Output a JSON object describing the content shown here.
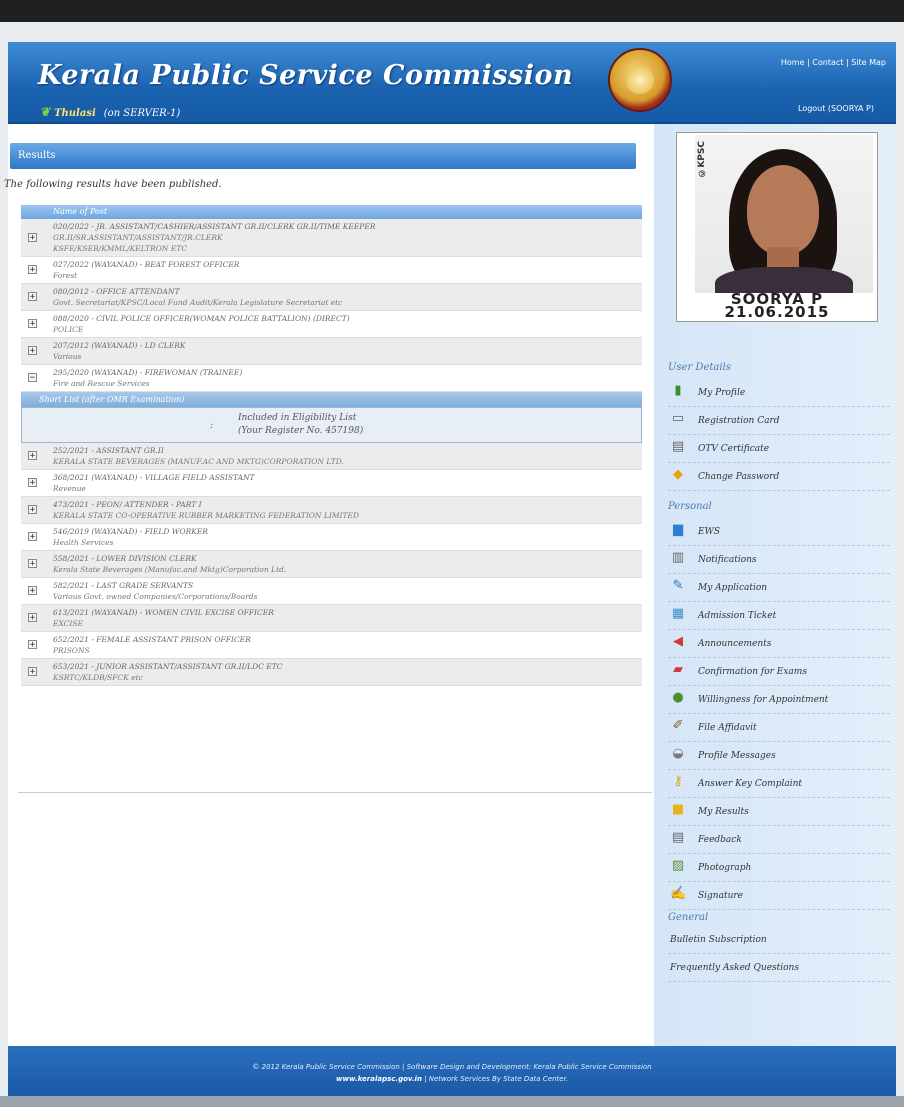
{
  "header": {
    "title": "Kerala Public Service Commission",
    "brand": "Thulasi",
    "server": "(on SERVER-1)",
    "links": [
      "Home",
      "Contact",
      "Site Map"
    ],
    "logout": "Logout (SOORYA P)"
  },
  "results": {
    "heading": "Results",
    "intro": "The following results have been published.",
    "column_header": "Name of Post",
    "rows_top": [
      {
        "lines": [
          "020/2022 - JR. ASSISTANT/CASHIER/ASSISTANT GR.II/CLERK GR.II/TIME KEEPER",
          "GR.II/SR.ASSISTANT/ASSISTANT/JR.CLERK",
          "KSFE/KSEB/KMML/KELTRON ETC"
        ],
        "expander": "+"
      },
      {
        "lines": [
          "027/2022 (WAYANAD) - BEAT FOREST OFFICER",
          "Forest"
        ],
        "expander": "+"
      },
      {
        "lines": [
          "080/2012 - OFFICE ATTENDANT",
          "Govt. Secretariat/KPSC/Local Fund Audit/Kerala Legislature Secretariat etc"
        ],
        "expander": "+"
      },
      {
        "lines": [
          "088/2020 - CIVIL POLICE OFFICER(WOMAN POLICE BATTALION) (DIRECT)",
          "POLICE"
        ],
        "expander": "+"
      },
      {
        "lines": [
          "207/2012 (WAYANAD) - LD CLERK",
          "Various"
        ],
        "expander": "+"
      },
      {
        "lines": [
          "295/2020 (WAYANAD) - FIREWOMAN (TRAINEE)",
          "Fire and Rescue Services"
        ],
        "expander": "−"
      }
    ],
    "shortlist": {
      "heading": "Short List (after OMR Examination)",
      "colon": ":",
      "line1": "Included in Eligibility List",
      "line2": "(Your Register No. 457198)"
    },
    "rows_bottom": [
      {
        "lines": [
          "252/2021 - ASSISTANT GR.II",
          "KERALA STATE BEVERAGES (MANUF.AC AND MKTG)CORPORATION LTD."
        ],
        "expander": "+"
      },
      {
        "lines": [
          "368/2021 (WAYANAD) - VILLAGE FIELD ASSISTANT",
          "Revenue"
        ],
        "expander": "+"
      },
      {
        "lines": [
          "473/2021 - PEON/ ATTENDER - PART I",
          "KERALA STATE CO-OPERATIVE RUBBER MARKETING FEDERATION LIMITED"
        ],
        "expander": "+"
      },
      {
        "lines": [
          "546/2019 (WAYANAD) - FIELD WORKER",
          "Health Services"
        ],
        "expander": "+"
      },
      {
        "lines": [
          "558/2021 - LOWER DIVISION CLERK",
          "Kerala State Beverages (Manufac.and Mktg)Corporation Ltd."
        ],
        "expander": "+"
      },
      {
        "lines": [
          "582/2021 - LAST GRADE SERVANTS",
          "Various Govt. owned Companies/Corporations/Boards"
        ],
        "expander": "+"
      },
      {
        "lines": [
          "613/2021 (WAYANAD) - WOMEN CIVIL EXCISE OFFICER",
          "EXCISE"
        ],
        "expander": "+"
      },
      {
        "lines": [
          "652/2021 - FEMALE ASSISTANT PRISON OFFICER",
          "PRISONS"
        ],
        "expander": "+"
      },
      {
        "lines": [
          "653/2021 - JUNIOR ASSISTANT/ASSISTANT GR.II/LDC ETC",
          "KSRTC/KLDB/SFCK etc"
        ],
        "expander": "+"
      }
    ]
  },
  "profile": {
    "watermark": "©KPSC",
    "name": "SOORYA P",
    "date": "21.06.2015"
  },
  "sidebar": {
    "user_title": "User Details",
    "user_items": [
      {
        "label": "My Profile",
        "icon": "profile-icon",
        "glyph": "▮",
        "color": "#3a8f2b"
      },
      {
        "label": "Registration Card",
        "icon": "registration-card-icon",
        "glyph": "▭",
        "color": "#666"
      },
      {
        "label": "OTV Certificate",
        "icon": "certificate-icon",
        "glyph": "▤",
        "color": "#666"
      },
      {
        "label": "Change Password",
        "icon": "password-icon",
        "glyph": "◆",
        "color": "#e8a21a"
      }
    ],
    "personal_title": "Personal",
    "personal_items": [
      {
        "label": "EWS",
        "icon": "ews-chart-icon",
        "glyph": "▆",
        "color": "#2d7fd1"
      },
      {
        "label": "Notifications",
        "icon": "notifications-icon",
        "glyph": "▥",
        "color": "#666"
      },
      {
        "label": "My Application",
        "icon": "application-icon",
        "glyph": "✎",
        "color": "#3b6fb8"
      },
      {
        "label": "Admission Ticket",
        "icon": "admission-ticket-icon",
        "glyph": "▦",
        "color": "#3b8dc7"
      },
      {
        "label": "Announcements",
        "icon": "megaphone-icon",
        "glyph": "◀",
        "color": "#d23a3a"
      },
      {
        "label": "Confirmation for Exams",
        "icon": "confirmation-icon",
        "glyph": "▰",
        "color": "#d23a3a"
      },
      {
        "label": "Willingness for Appointment",
        "icon": "willingness-icon",
        "glyph": "●",
        "color": "#4c8f2f"
      },
      {
        "label": "File Affidavit",
        "icon": "affidavit-icon",
        "glyph": "✐",
        "color": "#8a5a2a"
      },
      {
        "label": "Profile Messages",
        "icon": "messages-icon",
        "glyph": "◒",
        "color": "#7a7a7a"
      },
      {
        "label": "Answer Key Complaint",
        "icon": "key-icon",
        "glyph": "⚷",
        "color": "#e59a17"
      },
      {
        "label": "My Results",
        "icon": "results-icon",
        "glyph": "■",
        "color": "#e7b21a"
      },
      {
        "label": "Feedback",
        "icon": "feedback-icon",
        "glyph": "▤",
        "color": "#666"
      },
      {
        "label": "Photograph",
        "icon": "photograph-icon",
        "glyph": "▨",
        "color": "#5c8f3a"
      },
      {
        "label": "Signature",
        "icon": "signature-icon",
        "glyph": "✍",
        "color": "#4a6fa8"
      }
    ],
    "general_title": "General",
    "general_items": [
      {
        "label": "Bulletin Subscription"
      },
      {
        "label": "Frequently Asked Questions"
      }
    ]
  },
  "footer": {
    "line1": "© 2012 Kerala Public Service Commission | Software Design and Development: Kerala Public Service Commission",
    "line2_link": "www.keralapsc.gov.in",
    "line2_rest": " | Network Services By State Data Center."
  }
}
